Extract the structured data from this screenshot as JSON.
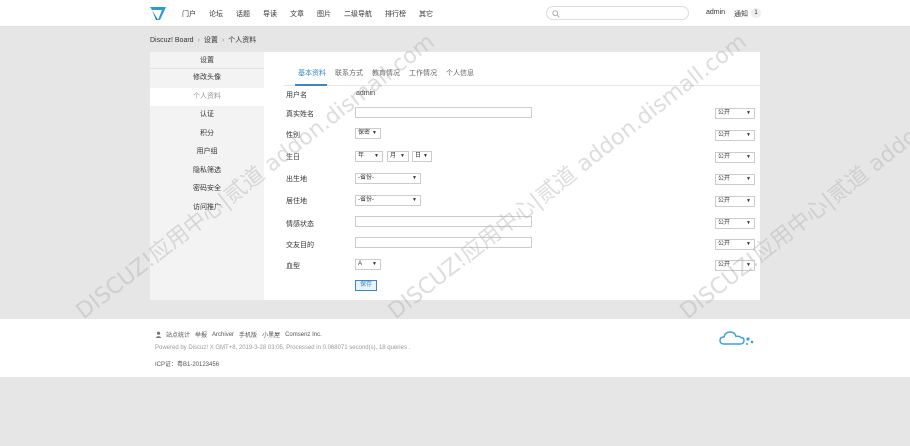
{
  "header": {
    "nav": [
      "门户",
      "论坛",
      "话题",
      "导读",
      "文章",
      "图片",
      "二级导航",
      "排行榜",
      "其它"
    ],
    "search_placeholder": "",
    "username": "admin",
    "notice_label": "通知",
    "notice_count": "1",
    "accent_color": "#3b88c3"
  },
  "breadcrumb": [
    "Discuz! Board",
    "设置",
    "个人资料"
  ],
  "sidebar": {
    "title": "设置",
    "items": [
      "修改头像",
      "个人资料",
      "认证",
      "积分",
      "用户组",
      "隐私筛选",
      "密码安全",
      "访问推广"
    ]
  },
  "tabs": [
    "基本资料",
    "联系方式",
    "教育情况",
    "工作情况",
    "个人信息"
  ],
  "form": {
    "username_label": "用户名",
    "username_value": "admin",
    "realname_label": "真实姓名",
    "gender_label": "性别",
    "gender_value": "保密",
    "birthday_label": "生日",
    "year_value": "年",
    "month_value": "月",
    "day_value": "日",
    "birthplace_label": "出生地",
    "residence_label": "居住地",
    "province_value": "-省份-",
    "marital_label": "情感状态",
    "purpose_label": "交友目的",
    "blood_label": "血型",
    "blood_value": "A",
    "privacy_value": "公开",
    "save_label": "保存"
  },
  "watermark": "DISCUZ!应用中心|贰道 addon.dismall.com",
  "footer": {
    "links": [
      "站点统计",
      "举报",
      "Archiver",
      "手机版",
      "小黑屋",
      "Comsenz Inc."
    ],
    "powered": "Powered by Discuz! X GMT+8, 2019-3-28 03:05, Processed in 0.068071 second(s), 18 queries .",
    "icp": "ICP证：粤B1-20123456"
  }
}
